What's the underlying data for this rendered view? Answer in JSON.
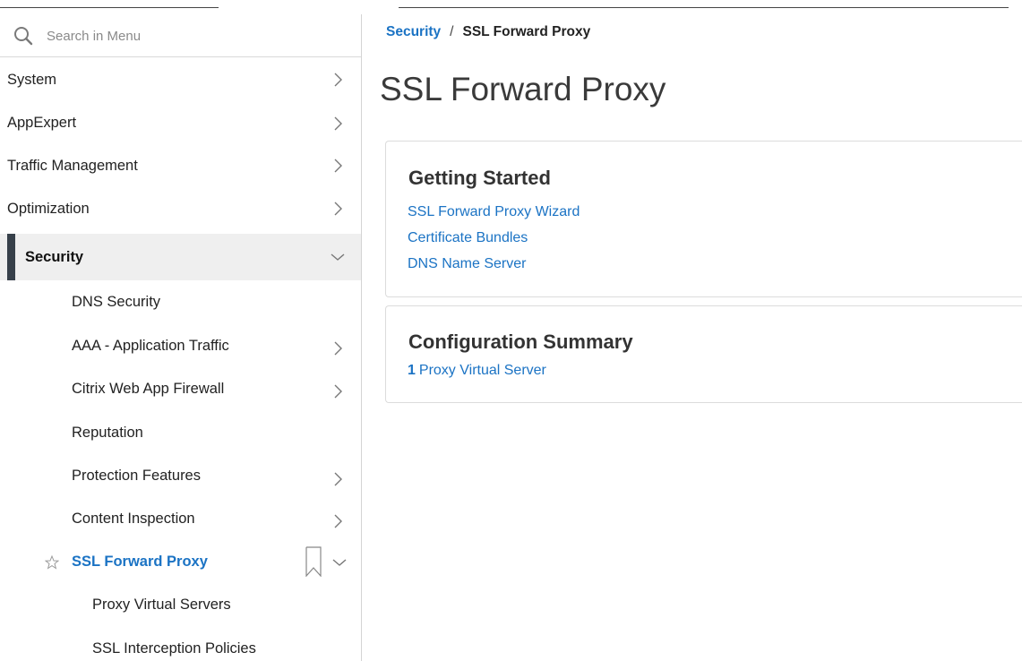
{
  "sidebar": {
    "search": {
      "placeholder": "Search in Menu",
      "value": ""
    },
    "items": [
      {
        "label": "System"
      },
      {
        "label": "AppExpert"
      },
      {
        "label": "Traffic Management"
      },
      {
        "label": "Optimization"
      },
      {
        "label": "Security"
      }
    ],
    "security_children": [
      {
        "label": "DNS Security"
      },
      {
        "label": "AAA - Application Traffic"
      },
      {
        "label": "Citrix Web App Firewall"
      },
      {
        "label": "Reputation"
      },
      {
        "label": "Protection Features"
      },
      {
        "label": "Content Inspection"
      },
      {
        "label": "SSL Forward Proxy"
      }
    ],
    "ssl_children": [
      {
        "label": "Proxy Virtual Servers"
      },
      {
        "label": "SSL Interception Policies"
      }
    ]
  },
  "breadcrumb": {
    "parent": "Security",
    "separator": "/",
    "current": "SSL Forward Proxy"
  },
  "page_title": "SSL Forward Proxy",
  "getting_started": {
    "title": "Getting Started",
    "links": [
      "SSL Forward Proxy Wizard",
      "Certificate Bundles",
      "DNS Name Server"
    ]
  },
  "config_summary": {
    "title": "Configuration Summary",
    "count": "1",
    "link_label": "Proxy Virtual Server"
  },
  "colors": {
    "link": "#1b73c4",
    "active_bar": "#37404a",
    "active_bg": "#efefef"
  }
}
